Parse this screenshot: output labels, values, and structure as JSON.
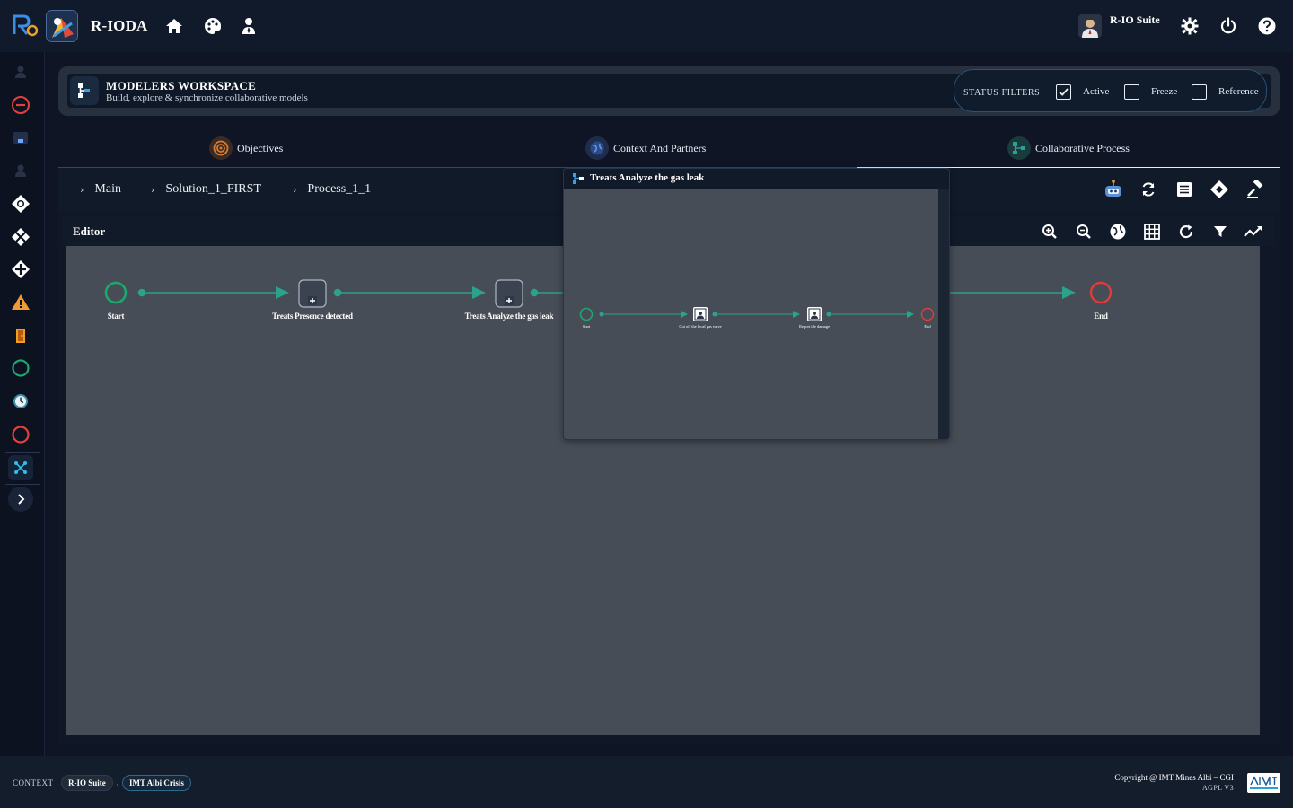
{
  "app": {
    "name": "R-IODA",
    "suite_name": "R-IO Suite"
  },
  "workspace": {
    "title": "MODELERS WORKSPACE",
    "subtitle": "Build, explore & synchronize collaborative models"
  },
  "status_filters": {
    "label": "STATUS FILTERS",
    "items": [
      {
        "label": "Active",
        "checked": true
      },
      {
        "label": "Freeze",
        "checked": false
      },
      {
        "label": "Reference",
        "checked": false
      }
    ]
  },
  "tabs": [
    {
      "label": "Objectives",
      "icon": "target-icon"
    },
    {
      "label": "Context And Partners",
      "icon": "globe-icon"
    },
    {
      "label": "Collaborative Process",
      "icon": "process-icon",
      "active": true
    }
  ],
  "breadcrumb": [
    "Main",
    "Solution_1_FIRST",
    "Process_1_1"
  ],
  "editor": {
    "title": "Editor",
    "nodes": {
      "start": "Start",
      "task1": "Treats Presence detected",
      "task2": "Treats Analyze the gas leak",
      "end": "End"
    }
  },
  "popup": {
    "title": "Treats Analyze the gas leak",
    "nodes": {
      "start": "Start",
      "task1": "Cut off the local gas valve",
      "task2": "Report the damage",
      "end": "End"
    }
  },
  "footer": {
    "context_label": "CONTEXT",
    "chips": [
      "R-IO Suite",
      "IMT Albi Crisis"
    ],
    "copyright": "Copyright @ IMT Mines Albi – CGI",
    "license": "AGPL V3"
  },
  "colors": {
    "flow": "#2ba28c",
    "start": "#1fa66f",
    "end": "#e23b3b",
    "canvas": "#474d57"
  }
}
